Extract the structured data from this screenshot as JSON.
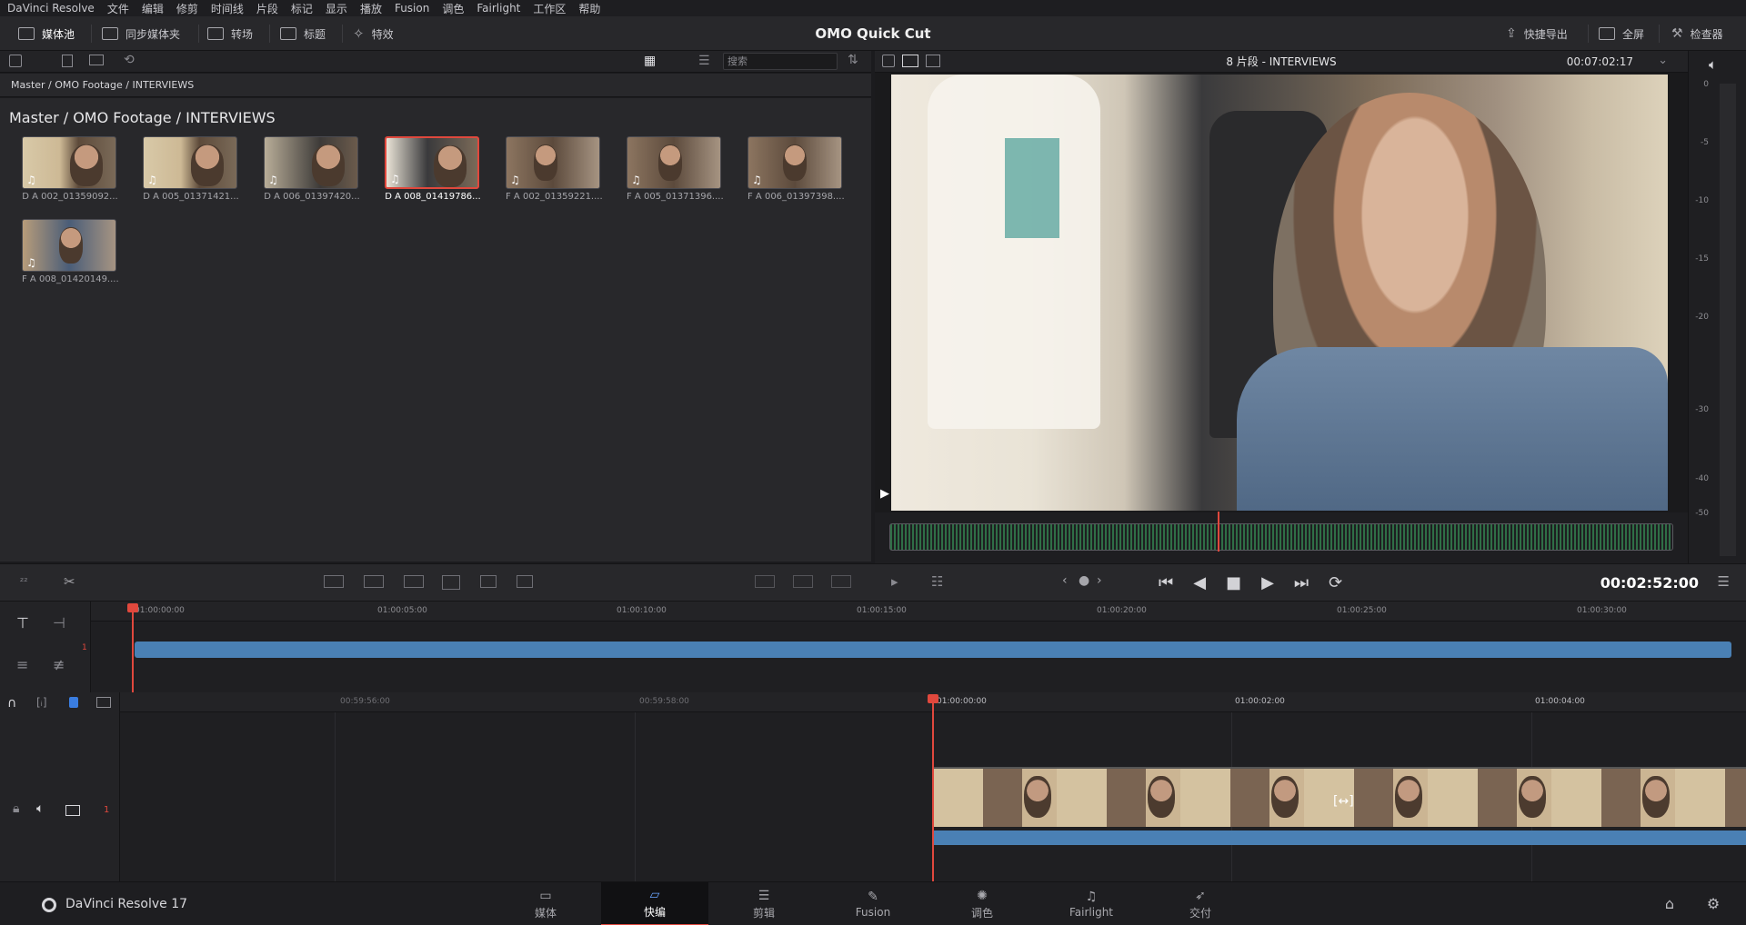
{
  "menubar": {
    "items": [
      "DaVinci Resolve",
      "文件",
      "编辑",
      "修剪",
      "时间线",
      "片段",
      "标记",
      "显示",
      "播放",
      "Fusion",
      "调色",
      "Fairlight",
      "工作区",
      "帮助"
    ]
  },
  "toolbar": {
    "media_pool": "媒体池",
    "sync_bin": "同步媒体夹",
    "transitions": "转场",
    "titles": "标题",
    "effects": "特效",
    "app_title": "OMO Quick Cut",
    "quick_export": "快捷导出",
    "fullscreen": "全屏",
    "inspector": "检查器"
  },
  "media_pool": {
    "search_placeholder": "搜索",
    "breadcrumb": "Master / OMO Footage / INTERVIEWS",
    "path_title": "Master / OMO Footage / INTERVIEWS",
    "clips": [
      {
        "name": "D A 002_01359092..."
      },
      {
        "name": "D A 005_01371421..."
      },
      {
        "name": "D A 006_01397420..."
      },
      {
        "name": "D A 008_01419786...",
        "selected": true
      },
      {
        "name": "F A 002_01359221...."
      },
      {
        "name": "F A 005_01371396...."
      },
      {
        "name": "F A 006_01397398...."
      },
      {
        "name": "F A 008_01420149...."
      }
    ]
  },
  "viewer": {
    "title": "8 片段 - INTERVIEWS",
    "timecode": "00:07:02:17",
    "meter_ticks": [
      "0",
      "-5",
      "-10",
      "-15",
      "-20",
      "-30",
      "-40",
      "-50"
    ]
  },
  "transport": {
    "timecode": "00:02:52:00"
  },
  "upper_timeline": {
    "labels": [
      "01:00:00:00",
      "01:00:05:00",
      "01:00:10:00",
      "01:00:15:00",
      "01:00:20:00",
      "01:00:25:00",
      "01:00:30:00"
    ],
    "track": "1"
  },
  "lower_timeline": {
    "labels": [
      "00:59:56:00",
      "00:59:58:00",
      "01:00:00:00",
      "01:00:02:00",
      "01:00:04:00"
    ],
    "track": "1"
  },
  "nav": {
    "brand": "DaVinci Resolve 17",
    "pages": [
      {
        "label": "媒体",
        "glyph": "▭"
      },
      {
        "label": "快编",
        "glyph": "▱",
        "active": true
      },
      {
        "label": "剪辑",
        "glyph": "☰"
      },
      {
        "label": "Fusion",
        "glyph": "✎"
      },
      {
        "label": "调色",
        "glyph": "✺"
      },
      {
        "label": "Fairlight",
        "glyph": "♫"
      },
      {
        "label": "交付",
        "glyph": "➶"
      }
    ]
  },
  "colors": {
    "accent_red": "#e0483d",
    "clip_blue": "#4a80b4",
    "waveform_green": "#2f6e46"
  }
}
